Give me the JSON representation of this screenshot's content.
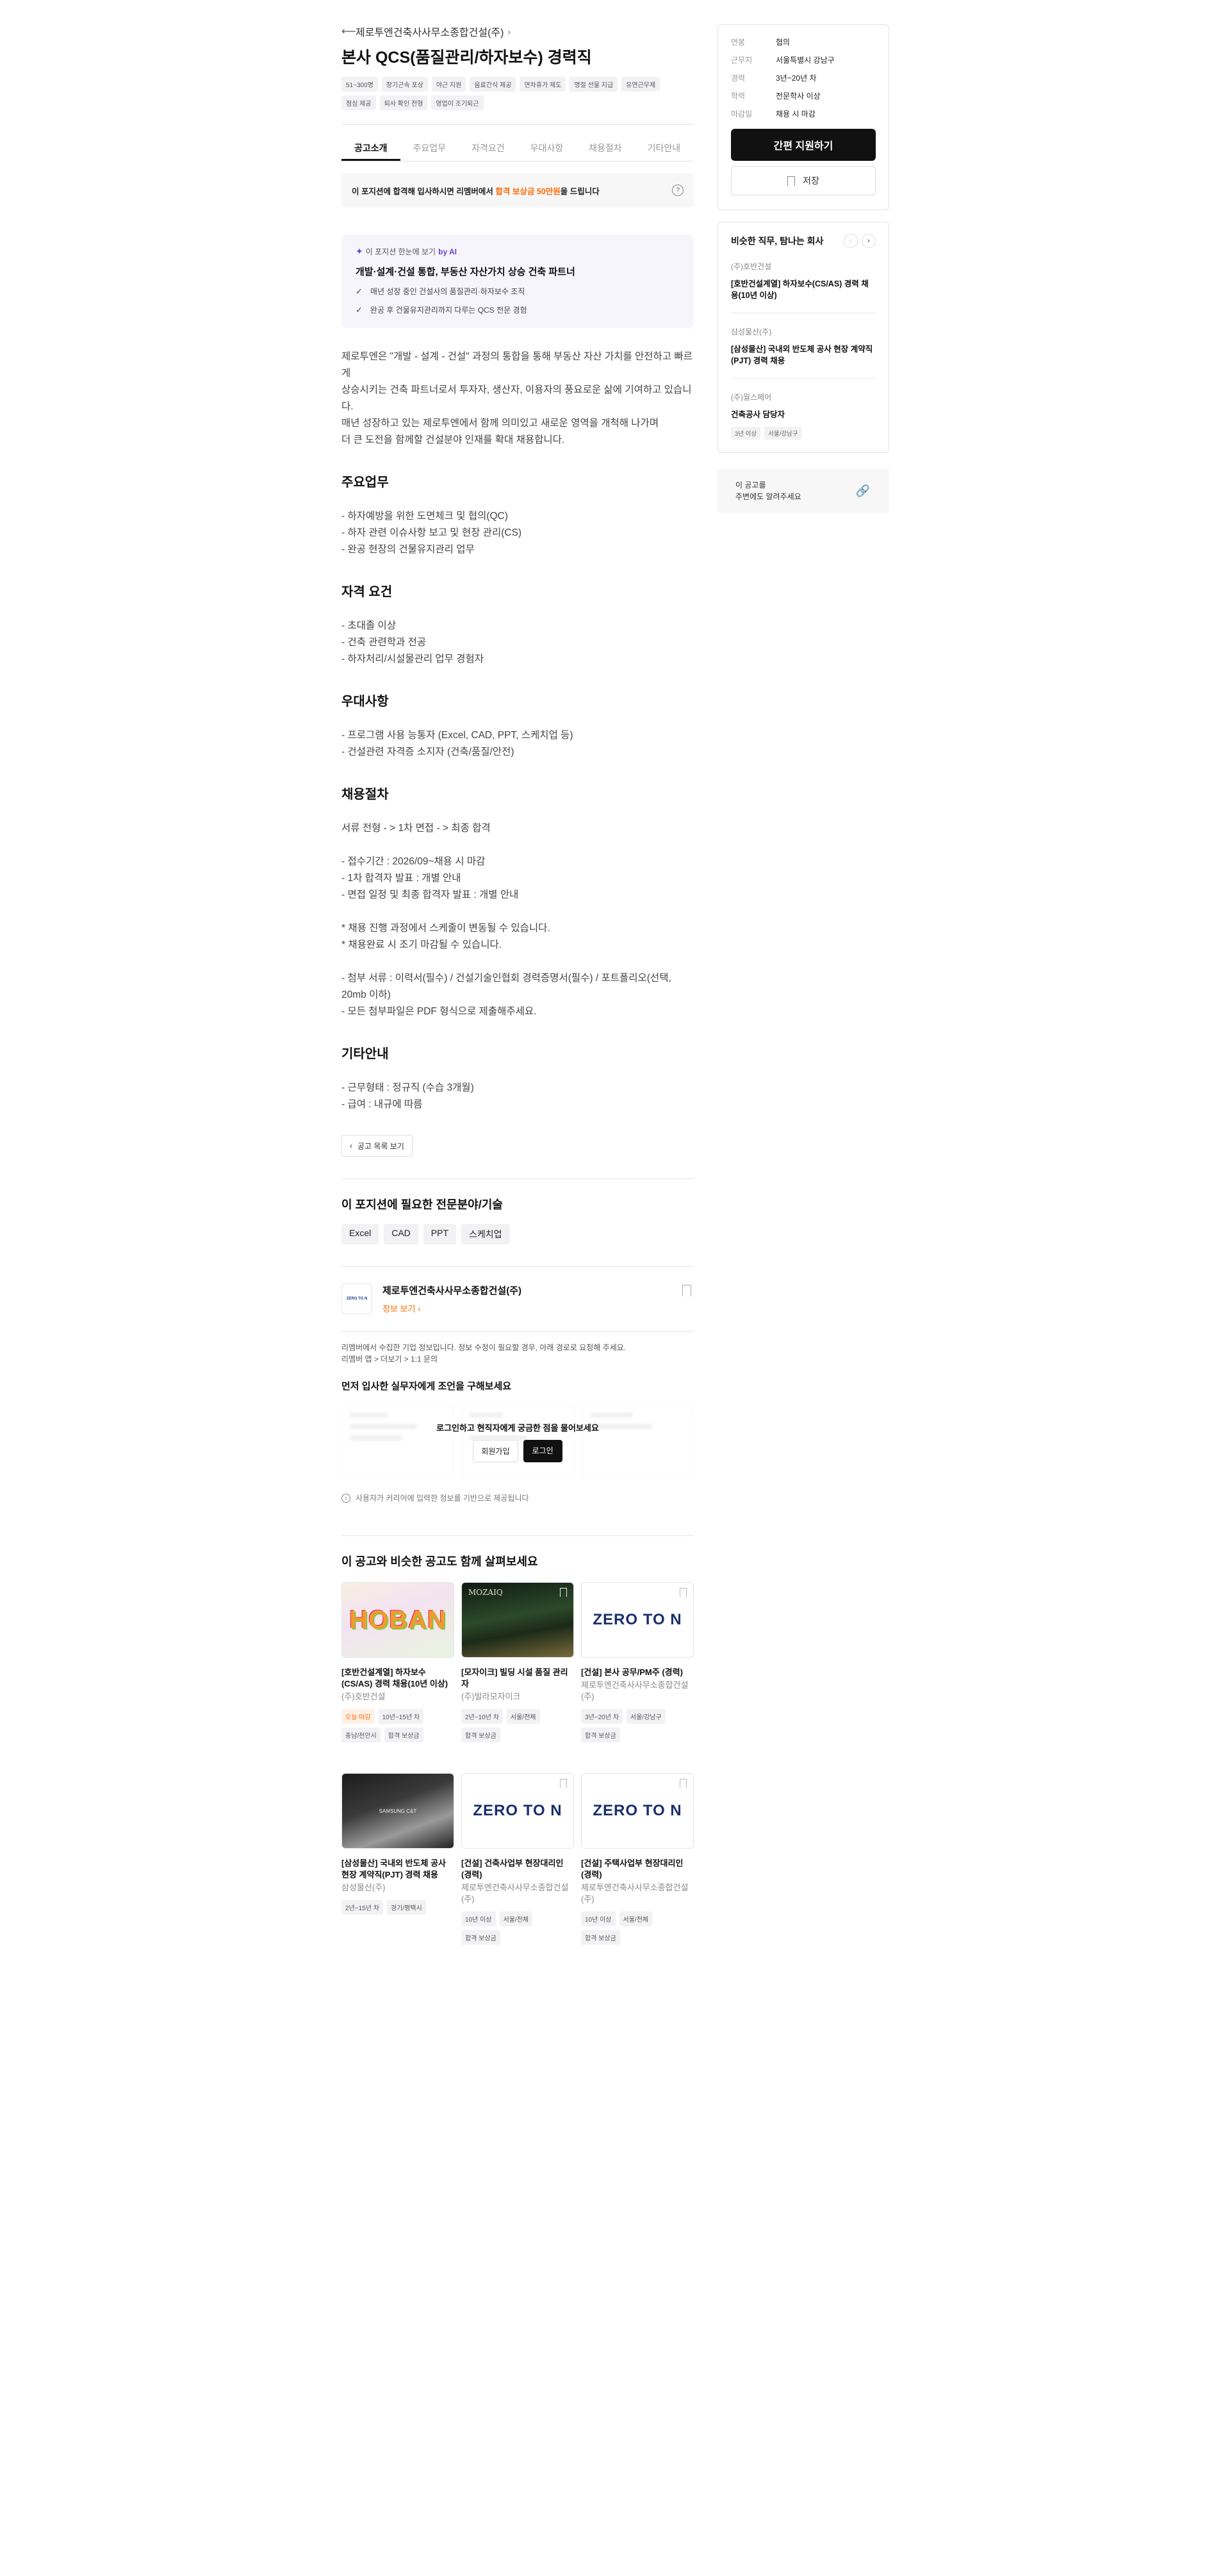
{
  "header": {
    "back_icon": "arrow-left-icon",
    "company": "제로투엔건축사사무소종합건설(주)",
    "chevron": "›",
    "title": "본사 QCS(품질관리/하자보수) 경력직",
    "tags": [
      "51~300명",
      "장기근속 포상",
      "야근 지원",
      "음료간식 제공",
      "연차휴가 제도",
      "명절 선물 지급",
      "유연근무제",
      "점심 제공",
      "퇴사 확인 전형",
      "영업이 조기퇴근"
    ]
  },
  "tabs": [
    "공고소개",
    "주요업무",
    "자격요건",
    "우대사항",
    "채용절차",
    "기타안내"
  ],
  "bonus": {
    "pre": "이 포지션에 합격해 입사하시면 리멤버에서 ",
    "highlight": "합격 보상금 50만원",
    "post": "을 드립니다",
    "help_icon": "?"
  },
  "ai": {
    "label": "이 포지션 한눈에 보기",
    "by": "by AI",
    "title": "개발·설계·건설 통합, 부동산 자산가치 상승 건축 파트너",
    "points": [
      "매년 성장 중인 건설사의 품질관리·하자보수 조직",
      "완공 후 건물유지관리까지 다루는 QCS 전문 경험"
    ]
  },
  "intro": [
    "제로투엔은 \"개발 - 설계 - 건설\" 과정의 통합을 통해 부동산 자산 가치를 안전하고 빠르게",
    "상승시키는 건축 파트너로서 투자자, 생산자, 이용자의 풍요로운 삶에 기여하고 있습니다.",
    "매년 성장하고 있는 제로투엔에서 함께 의미있고 새로운 영역을 개척해 나가며",
    "더 큰 도전을 함께할 건설분야 인재를 확대 채용합니다."
  ],
  "sections": {
    "duties": {
      "title": "주요업무",
      "lines": [
        "- 하자예방을 위한 도면체크 및 협의(QC)",
        "- 하자 관련 이슈사항 보고 및 현장 관리(CS)",
        "- 완공 현장의 건물유지관리 업무"
      ]
    },
    "qual": {
      "title": "자격 요건",
      "lines": [
        "- 초대졸 이상",
        "- 건축 관련학과 전공",
        "- 하자처리/시설물관리 업무 경험자"
      ]
    },
    "pref": {
      "title": "우대사항",
      "lines": [
        "- 프로그램 사용 능통자 (Excel, CAD, PPT, 스케치업 등)",
        "- 건설관련 자격증 소지자 (건축/품질/안전)"
      ]
    },
    "process": {
      "title": "채용절차",
      "line1": "서류 전형 - > 1차 면접 - > 최종 합격",
      "block2": [
        "- 접수기간 : 2026/09~채용 시 마감",
        "- 1차 합격자 발표 : 개별 안내",
        "- 면접 일정 및 최종 합격자 발표 : 개별 안내"
      ],
      "block3": [
        "* 채용 진행 과정에서 스케줄이 변동될 수 있습니다.",
        "* 채용완료 시 조기 마감될 수 있습니다."
      ],
      "block4": [
        "- 첨부 서류 : 이력서(필수) / 건설기술인협회 경력증명서(필수) / 포트폴리오(선택, 20mb 이하)",
        "- 모든 첨부파일은 PDF 형식으로 제출해주세요."
      ]
    },
    "etc": {
      "title": "기타안내",
      "lines": [
        "- 근무형태 : 정규직 (수습 3개월)",
        "- 급여 : 내규에 따름"
      ]
    }
  },
  "list_button": "공고 목록 보기",
  "skills": {
    "title": "이 포지션에 필요한 전문분야/기술",
    "items": [
      "Excel",
      "CAD",
      "PPT",
      "스케치업"
    ]
  },
  "company_card": {
    "logo_text": "ZERO TO N",
    "name": "제로투엔건축사사무소종합건설(주)",
    "more": "정보 보기 ›",
    "note1": "리멤버에서 수집한 기업 정보입니다. 정보 수정이 필요할 경우, 아래 경로로 요청해 주세요.",
    "note2": "리멤버 앱 > 더보기 > 1:1 문의"
  },
  "advice": {
    "title": "먼저 입사한 실무자에게 조언을 구해보세요",
    "message": "로그인하고 현직자에게 궁금한 점을 물어보세요",
    "join": "회원가입",
    "login": "로그인",
    "foot": "사용자가 커리어에 입력한 정보를 기반으로 제공됩니다"
  },
  "similar": {
    "title": "이 공고와 비슷한 공고도 함께 살펴보세요",
    "cards": [
      {
        "img": "hoban",
        "img_text": "HOBAN",
        "title": "[호반건설계열] 하자보수(CS/AS) 경력 채용(10년 이상)",
        "company": "(주)호반건설",
        "tags": [
          {
            "t": "오늘 마감",
            "o": true
          },
          {
            "t": "10년~15년 차"
          },
          {
            "t": "충남/천안시"
          },
          {
            "t": "합격 보상금"
          }
        ]
      },
      {
        "img": "mozaiq",
        "img_text": "MOZAIQ",
        "title": "[모자이크] 빌딩 시설 품질 관리자",
        "company": "(주)빌라모자이크",
        "tags": [
          {
            "t": "2년~10년 차"
          },
          {
            "t": "서울/전체"
          },
          {
            "t": "합격 보상금"
          }
        ]
      },
      {
        "img": "zero",
        "img_text": "ZERO TO N",
        "title": "[건설] 본사 공무/PM주 (경력)",
        "company": "제로투엔건축사사무소종합건설(주)",
        "tags": [
          {
            "t": "3년~20년 차"
          },
          {
            "t": "서울/강남구"
          },
          {
            "t": "합격 보상금"
          }
        ]
      },
      {
        "img": "samsung",
        "img_text": "SAMSUNG C&T",
        "title": "[삼성물산] 국내외 반도체 공사 현장 계약직(PJT) 경력 채용",
        "company": "삼성물산(주)",
        "tags": [
          {
            "t": "2년~15년 차"
          },
          {
            "t": "경기/평택시"
          }
        ]
      },
      {
        "img": "zero",
        "img_text": "ZERO TO N",
        "title": "[건설] 건축사업부 현장대리인 (경력)",
        "company": "제로투엔건축사사무소종합건설(주)",
        "tags": [
          {
            "t": "10년 이상"
          },
          {
            "t": "서울/전체"
          },
          {
            "t": "합격 보상금"
          }
        ]
      },
      {
        "img": "zero",
        "img_text": "ZERO TO N",
        "title": "[건설] 주택사업부 현장대리인 (경력)",
        "company": "제로투엔건축사사무소종합건설(주)",
        "tags": [
          {
            "t": "10년 이상"
          },
          {
            "t": "서울/전체"
          },
          {
            "t": "합격 보상금"
          }
        ]
      }
    ]
  },
  "sidebar": {
    "info": [
      {
        "k": "연봉",
        "v": "협의"
      },
      {
        "k": "근무지",
        "v": "서울특별시 강남구"
      },
      {
        "k": "경력",
        "v": "3년~20년 차"
      },
      {
        "k": "학력",
        "v": "전문학사 이상"
      },
      {
        "k": "마감일",
        "v": "채용 시 마감"
      }
    ],
    "apply": "간편 지원하기",
    "save": "저장",
    "similar_title": "비슷한 직무, 탐나는 회사",
    "prev": "‹",
    "next": "›",
    "similar_items": [
      {
        "co": "(주)호반건설",
        "title": "[호반건설계열] 하자보수(CS/AS) 경력 채용(10년 이상)",
        "tags": []
      },
      {
        "co": "삼성물산(주)",
        "title": "[삼성물산] 국내외 반도체 공사 현장 계약직(PJT) 경력 채용",
        "tags": []
      },
      {
        "co": "(주)월스페어",
        "title": "건축공사 담당자",
        "tags": [
          "3년 이상",
          "서울/강남구"
        ]
      }
    ],
    "share_line1": "이 공고를",
    "share_line2": "주변에도 알려주세요",
    "link_icon": "🔗"
  }
}
